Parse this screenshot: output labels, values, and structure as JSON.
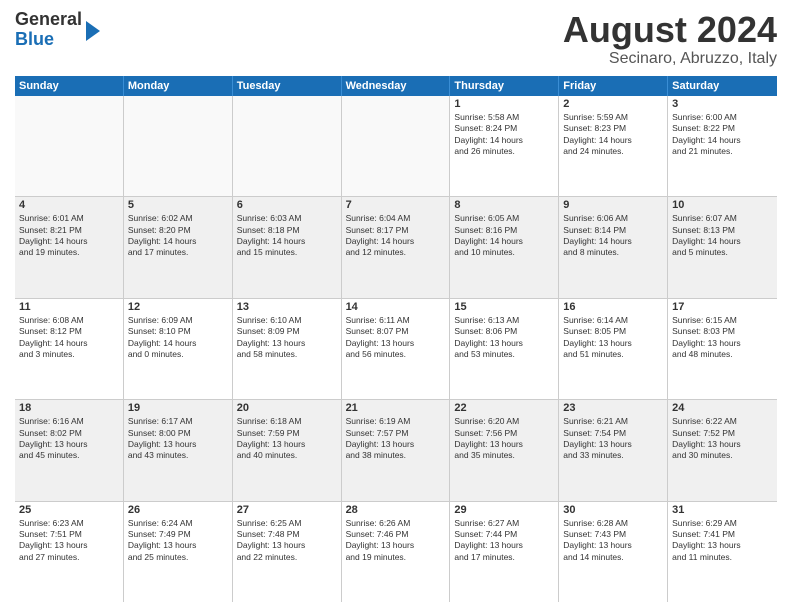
{
  "header": {
    "logo_general": "General",
    "logo_blue": "Blue",
    "month_year": "August 2024",
    "location": "Secinaro, Abruzzo, Italy"
  },
  "days_of_week": [
    "Sunday",
    "Monday",
    "Tuesday",
    "Wednesday",
    "Thursday",
    "Friday",
    "Saturday"
  ],
  "weeks": [
    [
      {
        "day": "",
        "text": "",
        "empty": true
      },
      {
        "day": "",
        "text": "",
        "empty": true
      },
      {
        "day": "",
        "text": "",
        "empty": true
      },
      {
        "day": "",
        "text": "",
        "empty": true
      },
      {
        "day": "1",
        "text": "Sunrise: 5:58 AM\nSunset: 8:24 PM\nDaylight: 14 hours\nand 26 minutes.",
        "empty": false
      },
      {
        "day": "2",
        "text": "Sunrise: 5:59 AM\nSunset: 8:23 PM\nDaylight: 14 hours\nand 24 minutes.",
        "empty": false
      },
      {
        "day": "3",
        "text": "Sunrise: 6:00 AM\nSunset: 8:22 PM\nDaylight: 14 hours\nand 21 minutes.",
        "empty": false
      }
    ],
    [
      {
        "day": "4",
        "text": "Sunrise: 6:01 AM\nSunset: 8:21 PM\nDaylight: 14 hours\nand 19 minutes.",
        "empty": false
      },
      {
        "day": "5",
        "text": "Sunrise: 6:02 AM\nSunset: 8:20 PM\nDaylight: 14 hours\nand 17 minutes.",
        "empty": false
      },
      {
        "day": "6",
        "text": "Sunrise: 6:03 AM\nSunset: 8:18 PM\nDaylight: 14 hours\nand 15 minutes.",
        "empty": false
      },
      {
        "day": "7",
        "text": "Sunrise: 6:04 AM\nSunset: 8:17 PM\nDaylight: 14 hours\nand 12 minutes.",
        "empty": false
      },
      {
        "day": "8",
        "text": "Sunrise: 6:05 AM\nSunset: 8:16 PM\nDaylight: 14 hours\nand 10 minutes.",
        "empty": false
      },
      {
        "day": "9",
        "text": "Sunrise: 6:06 AM\nSunset: 8:14 PM\nDaylight: 14 hours\nand 8 minutes.",
        "empty": false
      },
      {
        "day": "10",
        "text": "Sunrise: 6:07 AM\nSunset: 8:13 PM\nDaylight: 14 hours\nand 5 minutes.",
        "empty": false
      }
    ],
    [
      {
        "day": "11",
        "text": "Sunrise: 6:08 AM\nSunset: 8:12 PM\nDaylight: 14 hours\nand 3 minutes.",
        "empty": false
      },
      {
        "day": "12",
        "text": "Sunrise: 6:09 AM\nSunset: 8:10 PM\nDaylight: 14 hours\nand 0 minutes.",
        "empty": false
      },
      {
        "day": "13",
        "text": "Sunrise: 6:10 AM\nSunset: 8:09 PM\nDaylight: 13 hours\nand 58 minutes.",
        "empty": false
      },
      {
        "day": "14",
        "text": "Sunrise: 6:11 AM\nSunset: 8:07 PM\nDaylight: 13 hours\nand 56 minutes.",
        "empty": false
      },
      {
        "day": "15",
        "text": "Sunrise: 6:13 AM\nSunset: 8:06 PM\nDaylight: 13 hours\nand 53 minutes.",
        "empty": false
      },
      {
        "day": "16",
        "text": "Sunrise: 6:14 AM\nSunset: 8:05 PM\nDaylight: 13 hours\nand 51 minutes.",
        "empty": false
      },
      {
        "day": "17",
        "text": "Sunrise: 6:15 AM\nSunset: 8:03 PM\nDaylight: 13 hours\nand 48 minutes.",
        "empty": false
      }
    ],
    [
      {
        "day": "18",
        "text": "Sunrise: 6:16 AM\nSunset: 8:02 PM\nDaylight: 13 hours\nand 45 minutes.",
        "empty": false
      },
      {
        "day": "19",
        "text": "Sunrise: 6:17 AM\nSunset: 8:00 PM\nDaylight: 13 hours\nand 43 minutes.",
        "empty": false
      },
      {
        "day": "20",
        "text": "Sunrise: 6:18 AM\nSunset: 7:59 PM\nDaylight: 13 hours\nand 40 minutes.",
        "empty": false
      },
      {
        "day": "21",
        "text": "Sunrise: 6:19 AM\nSunset: 7:57 PM\nDaylight: 13 hours\nand 38 minutes.",
        "empty": false
      },
      {
        "day": "22",
        "text": "Sunrise: 6:20 AM\nSunset: 7:56 PM\nDaylight: 13 hours\nand 35 minutes.",
        "empty": false
      },
      {
        "day": "23",
        "text": "Sunrise: 6:21 AM\nSunset: 7:54 PM\nDaylight: 13 hours\nand 33 minutes.",
        "empty": false
      },
      {
        "day": "24",
        "text": "Sunrise: 6:22 AM\nSunset: 7:52 PM\nDaylight: 13 hours\nand 30 minutes.",
        "empty": false
      }
    ],
    [
      {
        "day": "25",
        "text": "Sunrise: 6:23 AM\nSunset: 7:51 PM\nDaylight: 13 hours\nand 27 minutes.",
        "empty": false
      },
      {
        "day": "26",
        "text": "Sunrise: 6:24 AM\nSunset: 7:49 PM\nDaylight: 13 hours\nand 25 minutes.",
        "empty": false
      },
      {
        "day": "27",
        "text": "Sunrise: 6:25 AM\nSunset: 7:48 PM\nDaylight: 13 hours\nand 22 minutes.",
        "empty": false
      },
      {
        "day": "28",
        "text": "Sunrise: 6:26 AM\nSunset: 7:46 PM\nDaylight: 13 hours\nand 19 minutes.",
        "empty": false
      },
      {
        "day": "29",
        "text": "Sunrise: 6:27 AM\nSunset: 7:44 PM\nDaylight: 13 hours\nand 17 minutes.",
        "empty": false
      },
      {
        "day": "30",
        "text": "Sunrise: 6:28 AM\nSunset: 7:43 PM\nDaylight: 13 hours\nand 14 minutes.",
        "empty": false
      },
      {
        "day": "31",
        "text": "Sunrise: 6:29 AM\nSunset: 7:41 PM\nDaylight: 13 hours\nand 11 minutes.",
        "empty": false
      }
    ]
  ]
}
